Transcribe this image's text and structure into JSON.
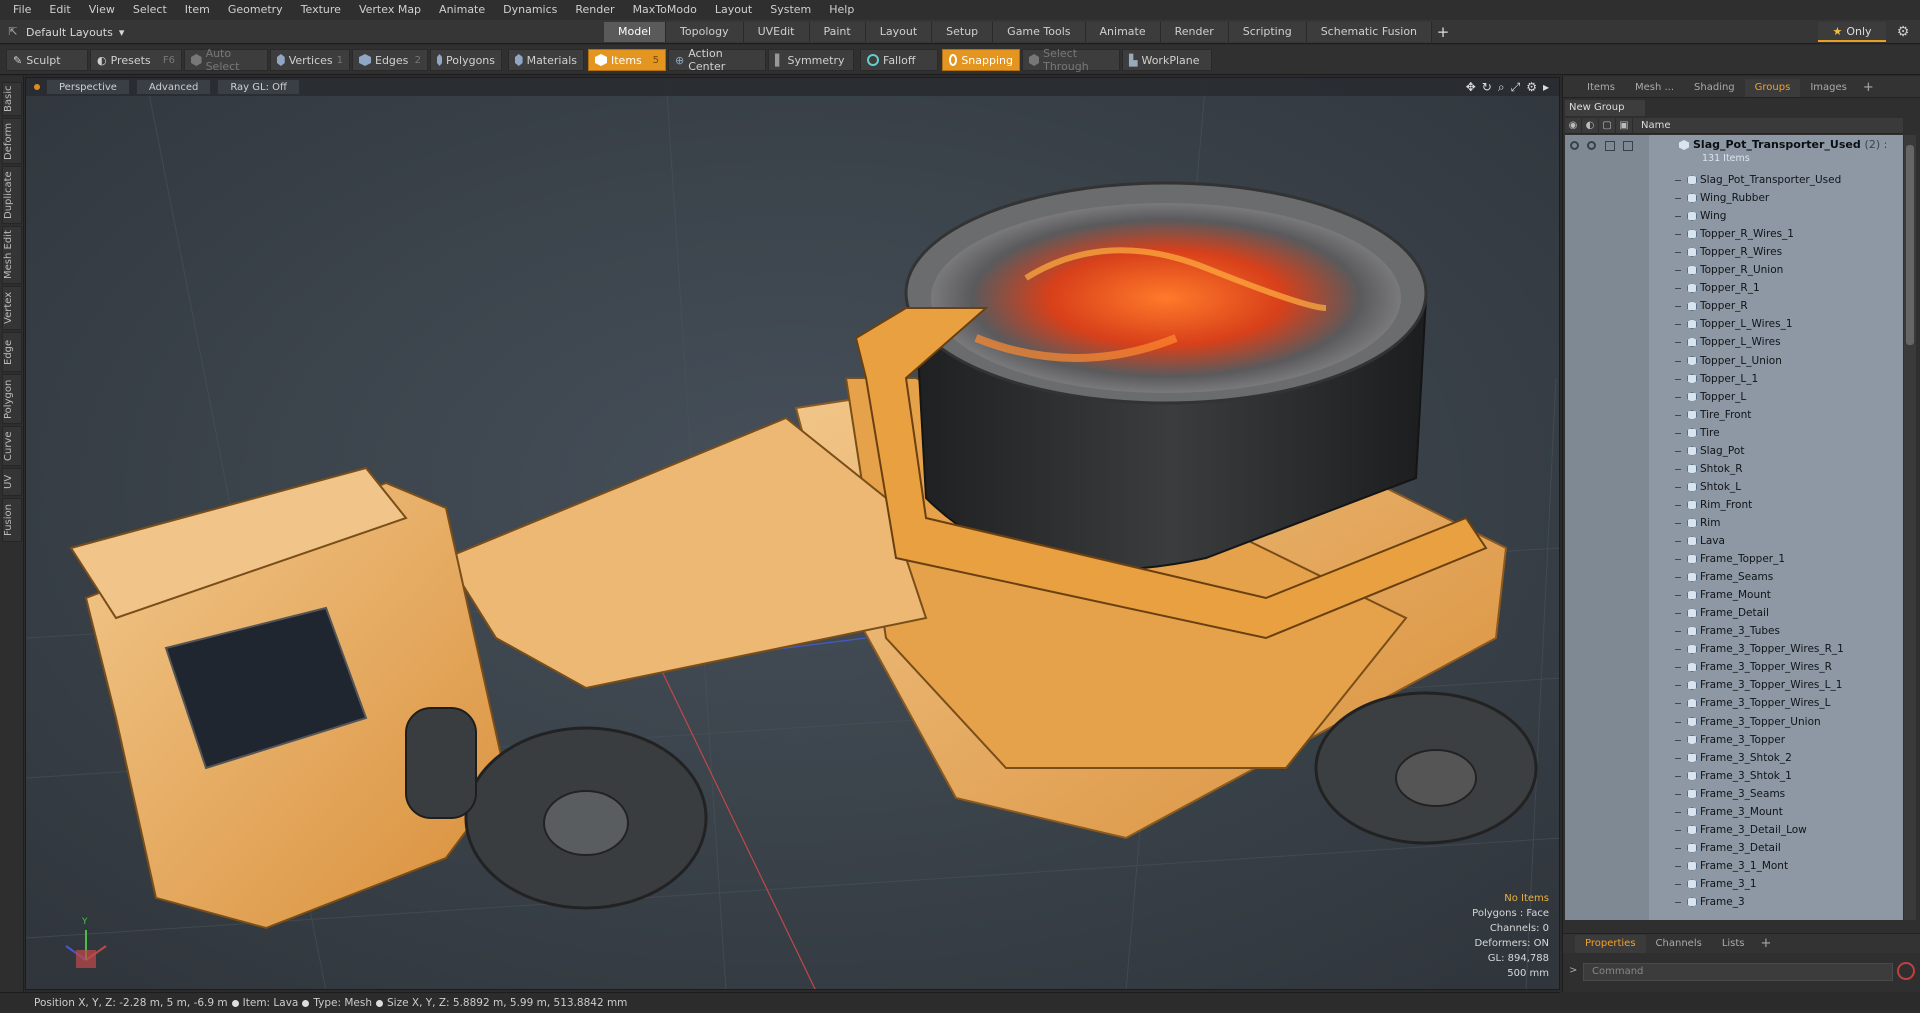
{
  "menu": [
    "File",
    "Edit",
    "View",
    "Select",
    "Item",
    "Geometry",
    "Texture",
    "Vertex Map",
    "Animate",
    "Dynamics",
    "Render",
    "MaxToModo",
    "Layout",
    "System",
    "Help"
  ],
  "layout": {
    "label": "Default Layouts"
  },
  "mode_tabs": [
    "Model",
    "Topology",
    "UVEdit",
    "Paint",
    "Layout",
    "Setup",
    "Game Tools",
    "Animate",
    "Render",
    "Scripting",
    "Schematic Fusion"
  ],
  "active_mode_tab": "Model",
  "only_label": "Only",
  "toolbar": {
    "sculpt": "Sculpt",
    "presets": "Presets",
    "presets_key": "F6",
    "auto_select": "Auto Select",
    "vertices": "Vertices",
    "vertices_key": "1",
    "edges": "Edges",
    "edges_key": "2",
    "polygons": "Polygons",
    "materials": "Materials",
    "items": "Items",
    "items_key": "5",
    "action_center": "Action Center",
    "symmetry": "Symmetry",
    "falloff": "Falloff",
    "snapping": "Snapping",
    "select_through": "Select Through",
    "workplane": "WorkPlane"
  },
  "left_tabs": [
    "Basic",
    "Deform",
    "Duplicate",
    "Mesh Edit",
    "Vertex",
    "Edge",
    "Polygon",
    "Curve",
    "UV",
    "Fusion"
  ],
  "viewport": {
    "perspective": "Perspective",
    "advanced": "Advanced",
    "raygl": "Ray GL: Off",
    "info": {
      "no_items": "No Items",
      "polygons": "Polygons : Face",
      "channels": "Channels: 0",
      "deformers": "Deformers: ON",
      "gl": "GL: 894,788",
      "scale": "500 mm"
    }
  },
  "right_panel": {
    "tabs": [
      "Items",
      "Mesh ...",
      "Shading",
      "Groups",
      "Images"
    ],
    "active_tab": "Groups",
    "new_group": "New Group",
    "name_col": "Name",
    "root": {
      "name": "Slag_Pot_Transporter_Used",
      "suffix": "(2) :",
      "count": "131 Items"
    },
    "items": [
      "Slag_Pot_Transporter_Used",
      "Wing_Rubber",
      "Wing",
      "Topper_R_Wires_1",
      "Topper_R_Wires",
      "Topper_R_Union",
      "Topper_R_1",
      "Topper_R",
      "Topper_L_Wires_1",
      "Topper_L_Wires",
      "Topper_L_Union",
      "Topper_L_1",
      "Topper_L",
      "Tire_Front",
      "Tire",
      "Slag_Pot",
      "Shtok_R",
      "Shtok_L",
      "Rim_Front",
      "Rim",
      "Lava",
      "Frame_Topper_1",
      "Frame_Seams",
      "Frame_Mount",
      "Frame_Detail",
      "Frame_3_Tubes",
      "Frame_3_Topper_Wires_R_1",
      "Frame_3_Topper_Wires_R",
      "Frame_3_Topper_Wires_L_1",
      "Frame_3_Topper_Wires_L",
      "Frame_3_Topper_Union",
      "Frame_3_Topper",
      "Frame_3_Shtok_2",
      "Frame_3_Shtok_1",
      "Frame_3_Seams",
      "Frame_3_Mount",
      "Frame_3_Detail_Low",
      "Frame_3_Detail",
      "Frame_3_1_Mont",
      "Frame_3_1",
      "Frame_3"
    ],
    "bottom_tabs": [
      "Properties",
      "Channels",
      "Lists"
    ],
    "active_bottom_tab": "Properties",
    "command_placeholder": "Command"
  },
  "status": {
    "position": "Position X, Y, Z:  -2.28 m, 5 m, -6.9 m",
    "item": "Item:  Lava",
    "type": "Type:  Mesh",
    "size": "Size X, Y, Z:   5.8892 m, 5.99 m, 513.8842 mm"
  },
  "colors": {
    "accent": "#e3951f",
    "tree_bg": "#8d98a4",
    "viewport_bg": "#3a4149"
  }
}
